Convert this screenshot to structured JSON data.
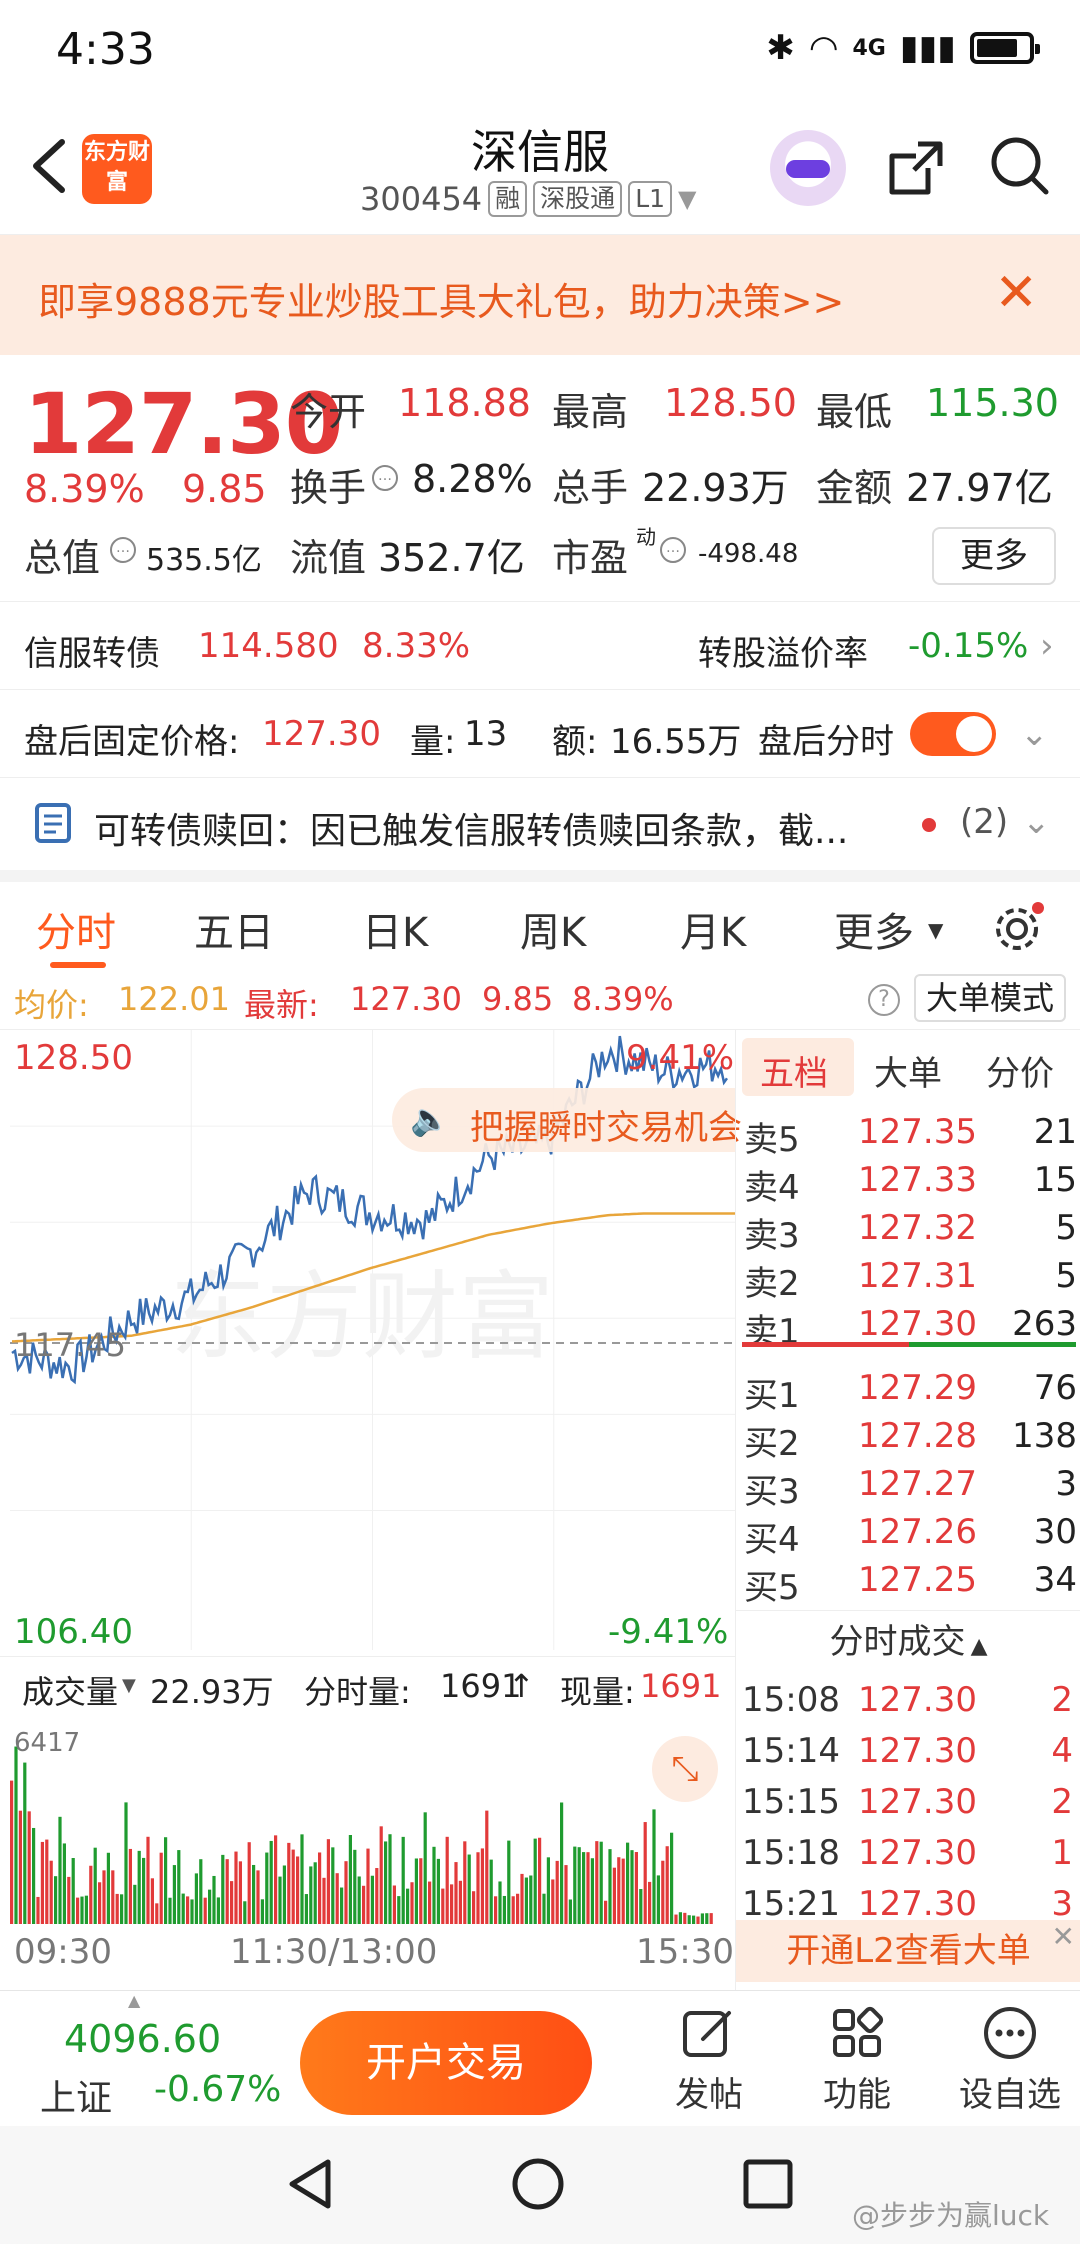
{
  "status_bar": {
    "time": "4:33",
    "network": "4G"
  },
  "header": {
    "logo_text": "东方财富",
    "stock_name": "深信服",
    "stock_code": "300454",
    "tags": [
      "融",
      "深股通",
      "L1"
    ]
  },
  "banner": {
    "text": "即享9888元专业炒股工具大礼包，助力决策>>"
  },
  "quote": {
    "price": "127.30",
    "change_pct": "8.39%",
    "change_amt": "9.85",
    "open_label": "今开",
    "open": "118.88",
    "high_label": "最高",
    "high": "128.50",
    "low_label": "最低",
    "low": "115.30",
    "turnover_label": "换手",
    "turnover": "8.28%",
    "volume_label": "总手",
    "volume": "22.93万",
    "amount_label": "金额",
    "amount": "27.97亿",
    "mktcap_label": "总值",
    "mktcap": "535.5亿",
    "float_label": "流值",
    "float": "352.7亿",
    "pe_label": "市盈",
    "pe_sup": "动",
    "pe": "-498.48",
    "more_label": "更多"
  },
  "bond": {
    "name": "信服转债",
    "price": "114.580",
    "pct": "8.33%",
    "premium_label": "转股溢价率",
    "premium": "-0.15%"
  },
  "after_hours": {
    "price_label": "盘后固定价格:",
    "price": "127.30",
    "vol_label": "量:",
    "vol": "13",
    "amt_label": "额:",
    "amt": "16.55万",
    "toggle_label": "盘后分时"
  },
  "notice": {
    "text": "可转债赎回：因已触发信服转债赎回条款，截...",
    "count": "(2)"
  },
  "tabs": [
    "分时",
    "五日",
    "日K",
    "周K",
    "月K",
    "更多"
  ],
  "summary": {
    "avg_label": "均价:",
    "avg": "122.01",
    "latest_label": "最新:",
    "latest": "127.30",
    "chg": "9.85",
    "pct": "8.39%",
    "mode_label": "大单模式"
  },
  "chart": {
    "y_high": "128.50",
    "y_low": "106.40",
    "y_ref": "117.45",
    "pct_high": "9.41%",
    "pct_low": "-9.41%",
    "promo": "把握瞬时交易机会",
    "watermark": "东方财富",
    "vol_label": "成交量",
    "vol_total": "22.93万",
    "tick_vol_label": "分时量:",
    "tick_vol": "1691",
    "cur_vol_label": "现量:",
    "cur_vol": "1691",
    "vol_max": "6417",
    "x_labels": [
      "09:30",
      "11:30/13:00",
      "15:30"
    ]
  },
  "chart_data": {
    "type": "line",
    "series": [
      {
        "name": "均价",
        "values": [
          117.4,
          117.5,
          117.6,
          118.0,
          118.6,
          119.3,
          120.0,
          120.6,
          121.2,
          121.6,
          121.9,
          122.0,
          122.01
        ]
      },
      {
        "name": "最新",
        "values": [
          117.0,
          116.5,
          118.2,
          119.0,
          120.6,
          122.8,
          122.0,
          121.7,
          124.0,
          124.5,
          127.8,
          127.0,
          127.3
        ]
      }
    ],
    "ylim": [
      106.4,
      128.5
    ]
  },
  "order_book": {
    "tabs": [
      "五档",
      "大单",
      "分价"
    ],
    "asks": [
      {
        "label": "卖5",
        "price": "127.35",
        "vol": "21"
      },
      {
        "label": "卖4",
        "price": "127.33",
        "vol": "15"
      },
      {
        "label": "卖3",
        "price": "127.32",
        "vol": "5"
      },
      {
        "label": "卖2",
        "price": "127.31",
        "vol": "5"
      },
      {
        "label": "卖1",
        "price": "127.30",
        "vol": "263"
      }
    ],
    "bids": [
      {
        "label": "买1",
        "price": "127.29",
        "vol": "76"
      },
      {
        "label": "买2",
        "price": "127.28",
        "vol": "138"
      },
      {
        "label": "买3",
        "price": "127.27",
        "vol": "3"
      },
      {
        "label": "买4",
        "price": "127.26",
        "vol": "30"
      },
      {
        "label": "买5",
        "price": "127.25",
        "vol": "34"
      }
    ],
    "trades_title": "分时成交",
    "trades": [
      {
        "time": "15:08",
        "price": "127.30",
        "vol": "2"
      },
      {
        "time": "15:14",
        "price": "127.30",
        "vol": "4"
      },
      {
        "time": "15:15",
        "price": "127.30",
        "vol": "2"
      },
      {
        "time": "15:18",
        "price": "127.30",
        "vol": "1"
      },
      {
        "time": "15:21",
        "price": "127.30",
        "vol": "3"
      }
    ],
    "l2_label": "开通L2查看大单"
  },
  "bottom": {
    "index_value": "4096.60",
    "index_name": "上证",
    "index_pct": "-0.67%",
    "trade_label": "开户交易",
    "nav": [
      "发帖",
      "功能",
      "设自选"
    ]
  },
  "watermark_credit": "@步步为赢luck",
  "colors": {
    "up": "#e23a3a",
    "down": "#1f9b2f",
    "accent": "#ff5a1e",
    "price_line": "#3a6fb3",
    "avg_line": "#e8a53a"
  }
}
